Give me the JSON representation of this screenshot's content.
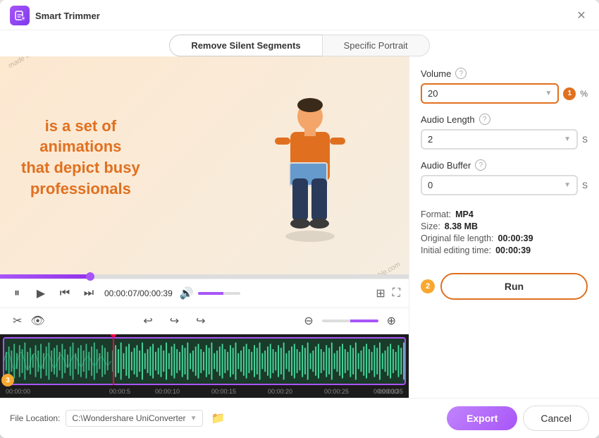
{
  "window": {
    "title": "Smart Trimmer",
    "close_icon": "✕"
  },
  "tabs": [
    {
      "id": "remove-silent",
      "label": "Remove Silent Segments",
      "active": true
    },
    {
      "id": "specific-portrait",
      "label": "Specific Portrait",
      "active": false
    }
  ],
  "video": {
    "watermark": "made with Biteable.com",
    "text_line1": "is a set of",
    "text_line2": "animations",
    "text_line3": "that depict busy",
    "text_line4": "professionals"
  },
  "playback": {
    "current_time": "00:00:07",
    "total_time": "00:00:39",
    "time_display": "00:00:07/00:00:39"
  },
  "right_panel": {
    "volume_label": "Volume",
    "volume_value": "20",
    "volume_unit": "%",
    "audio_length_label": "Audio Length",
    "audio_length_value": "2",
    "audio_length_unit": "S",
    "audio_buffer_label": "Audio Buffer",
    "audio_buffer_value": "0",
    "audio_buffer_unit": "S",
    "format_label": "Format:",
    "format_value": "MP4",
    "size_label": "Size:",
    "size_value": "8.38 MB",
    "original_length_label": "Original file length:",
    "original_length_value": "00:00:39",
    "initial_time_label": "Initial editing time:",
    "initial_time_value": "00:00:39",
    "badge_1": "1",
    "badge_2": "2",
    "run_button": "Run"
  },
  "timeline": {
    "timestamps": [
      "00:00:00",
      "00:00:5",
      "00:00:10",
      "00:00:15",
      "00:00:20",
      "00:00:25",
      "00:00:30",
      "00:00:35"
    ],
    "badge_3": "3"
  },
  "bottom": {
    "file_location_label": "File Location:",
    "file_path": "C:\\Wondershare UniConverter",
    "export_button": "Export",
    "cancel_button": "Cancel"
  }
}
